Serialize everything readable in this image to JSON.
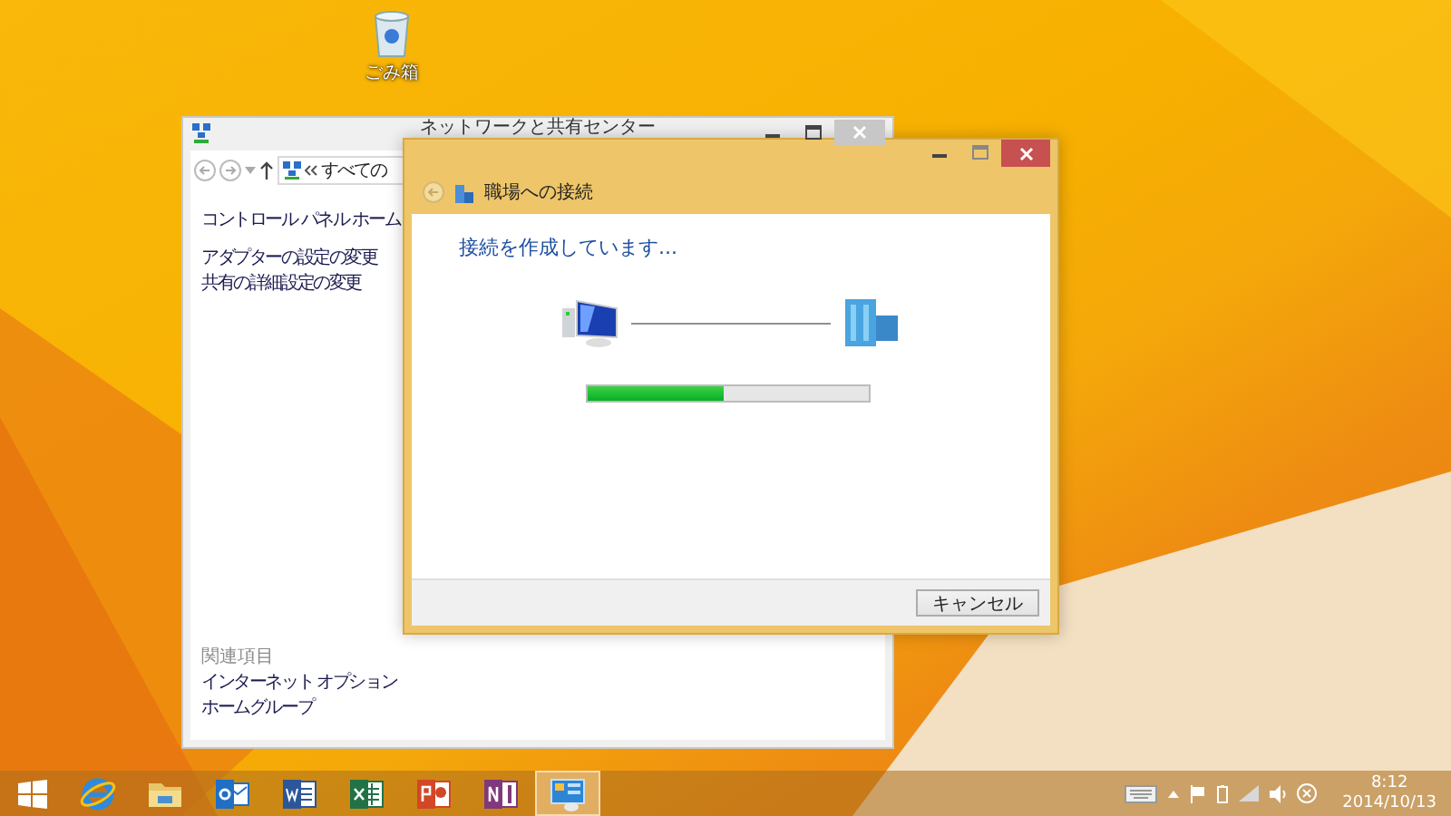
{
  "desktop": {
    "icons": [
      {
        "kind": "recycle-bin",
        "label": "ごみ箱"
      }
    ]
  },
  "background_window": {
    "title": "ネットワークと共有センター",
    "address": "すべての",
    "sidebar_links": [
      {
        "label": "コントロール パネル ホーム"
      },
      {
        "label": "アダプターの設定の変更"
      },
      {
        "label": "共有の詳細設定の変更"
      }
    ],
    "related_heading": "関連項目",
    "related_links": [
      {
        "label": "インターネット オプション"
      },
      {
        "label": "ホームグループ"
      }
    ]
  },
  "dialog": {
    "title": "職場への接続",
    "status": "接続を作成しています...",
    "progress": {
      "level": 0.49
    },
    "buttons": [
      "キャンセル"
    ]
  },
  "taskbar": {
    "apps": [
      {
        "kind": "browser",
        "selected": false
      },
      {
        "kind": "folder",
        "selected": false
      },
      {
        "kind": "mail",
        "selected": false
      },
      {
        "kind": "document",
        "selected": false
      },
      {
        "kind": "spreadsheet",
        "selected": false
      },
      {
        "kind": "presentation",
        "selected": false
      },
      {
        "kind": "notebook",
        "selected": false
      },
      {
        "kind": "control-panel",
        "selected": true
      }
    ],
    "clock": {
      "time": "8:12",
      "date": "2014/10/13"
    }
  }
}
